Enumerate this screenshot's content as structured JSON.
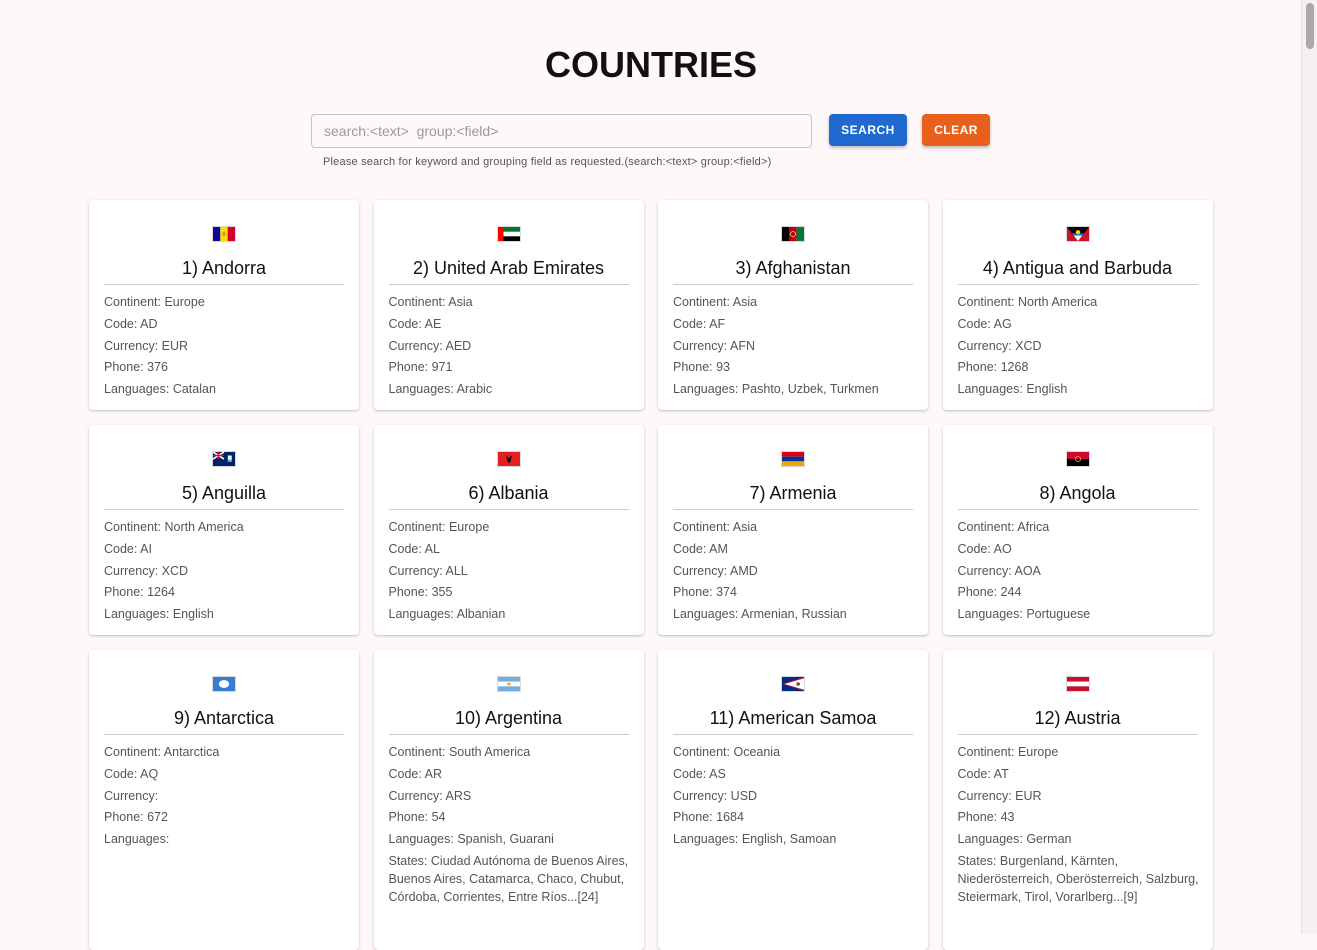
{
  "page": {
    "title": "COUNTRIES"
  },
  "search": {
    "placeholder": "search:<text>  group:<field>",
    "value": "",
    "helper": "Please search for keyword and grouping field as requested.(search:<text> group:<field>)",
    "search_label": "SEARCH",
    "clear_label": "CLEAR"
  },
  "labels": {
    "continent": "Continent:",
    "code": "Code:",
    "currency": "Currency:",
    "phone": "Phone:",
    "languages": "Languages:",
    "states": "States:"
  },
  "countries": [
    {
      "title": "1) Andorra",
      "flag": "andorra-flag-icon",
      "continent": "Europe",
      "code": "AD",
      "currency": "EUR",
      "phone": "376",
      "languages": "Catalan"
    },
    {
      "title": "2) United Arab Emirates",
      "flag": "uae-flag-icon",
      "continent": "Asia",
      "code": "AE",
      "currency": "AED",
      "phone": "971",
      "languages": "Arabic"
    },
    {
      "title": "3) Afghanistan",
      "flag": "afghanistan-flag-icon",
      "continent": "Asia",
      "code": "AF",
      "currency": "AFN",
      "phone": "93",
      "languages": "Pashto, Uzbek, Turkmen"
    },
    {
      "title": "4) Antigua and Barbuda",
      "flag": "antigua-flag-icon",
      "continent": "North America",
      "code": "AG",
      "currency": "XCD",
      "phone": "1268",
      "languages": "English"
    },
    {
      "title": "5) Anguilla",
      "flag": "anguilla-flag-icon",
      "continent": "North America",
      "code": "AI",
      "currency": "XCD",
      "phone": "1264",
      "languages": "English"
    },
    {
      "title": "6) Albania",
      "flag": "albania-flag-icon",
      "continent": "Europe",
      "code": "AL",
      "currency": "ALL",
      "phone": "355",
      "languages": "Albanian"
    },
    {
      "title": "7) Armenia",
      "flag": "armenia-flag-icon",
      "continent": "Asia",
      "code": "AM",
      "currency": "AMD",
      "phone": "374",
      "languages": "Armenian, Russian"
    },
    {
      "title": "8) Angola",
      "flag": "angola-flag-icon",
      "continent": "Africa",
      "code": "AO",
      "currency": "AOA",
      "phone": "244",
      "languages": "Portuguese"
    },
    {
      "title": "9) Antarctica",
      "flag": "antarctica-flag-icon",
      "continent": "Antarctica",
      "code": "AQ",
      "currency": "",
      "phone": "672",
      "languages": ""
    },
    {
      "title": "10) Argentina",
      "flag": "argentina-flag-icon",
      "continent": "South America",
      "code": "AR",
      "currency": "ARS",
      "phone": "54",
      "languages": "Spanish, Guarani",
      "states": "Ciudad Autónoma de Buenos Aires, Buenos Aires, Catamarca, Chaco, Chubut, Córdoba, Corrientes, Entre Ríos...[24]"
    },
    {
      "title": "11) American Samoa",
      "flag": "american-samoa-flag-icon",
      "continent": "Oceania",
      "code": "AS",
      "currency": "USD",
      "phone": "1684",
      "languages": "English, Samoan"
    },
    {
      "title": "12) Austria",
      "flag": "austria-flag-icon",
      "continent": "Europe",
      "code": "AT",
      "currency": "EUR",
      "phone": "43",
      "languages": "German",
      "states": "Burgenland, Kärnten, Niederösterreich, Oberösterreich, Salzburg, Steiermark, Tirol, Vorarlberg...[9]"
    }
  ]
}
